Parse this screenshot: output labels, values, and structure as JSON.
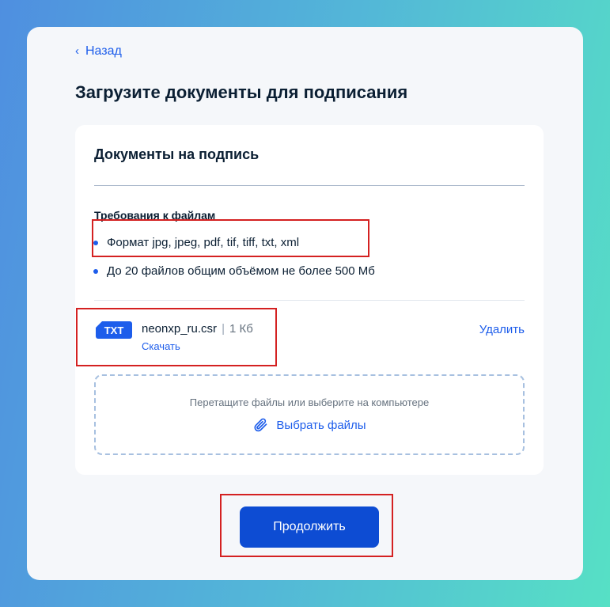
{
  "nav": {
    "back_label": "Назад"
  },
  "page": {
    "title": "Загрузите документы для подписания"
  },
  "documents": {
    "title": "Документы на подпись",
    "requirements_title": "Требования к файлам",
    "requirements": [
      "Формат jpg, jpeg, pdf, tif, tiff, txt, xml",
      "До 20 файлов общим объёмом не более 500 Мб"
    ],
    "file": {
      "type_badge": "TXT",
      "name": "neonxp_ru.csr",
      "size": "1 Кб",
      "download_label": "Скачать",
      "delete_label": "Удалить"
    },
    "dropzone": {
      "hint": "Перетащите файлы или выберите на компьютере",
      "pick_label": "Выбрать файлы",
      "icon": "paperclip-icon"
    }
  },
  "actions": {
    "continue_label": "Продолжить"
  },
  "colors": {
    "accent": "#1d5deb",
    "primary_button": "#0d4cd3",
    "highlight": "#d42121"
  }
}
